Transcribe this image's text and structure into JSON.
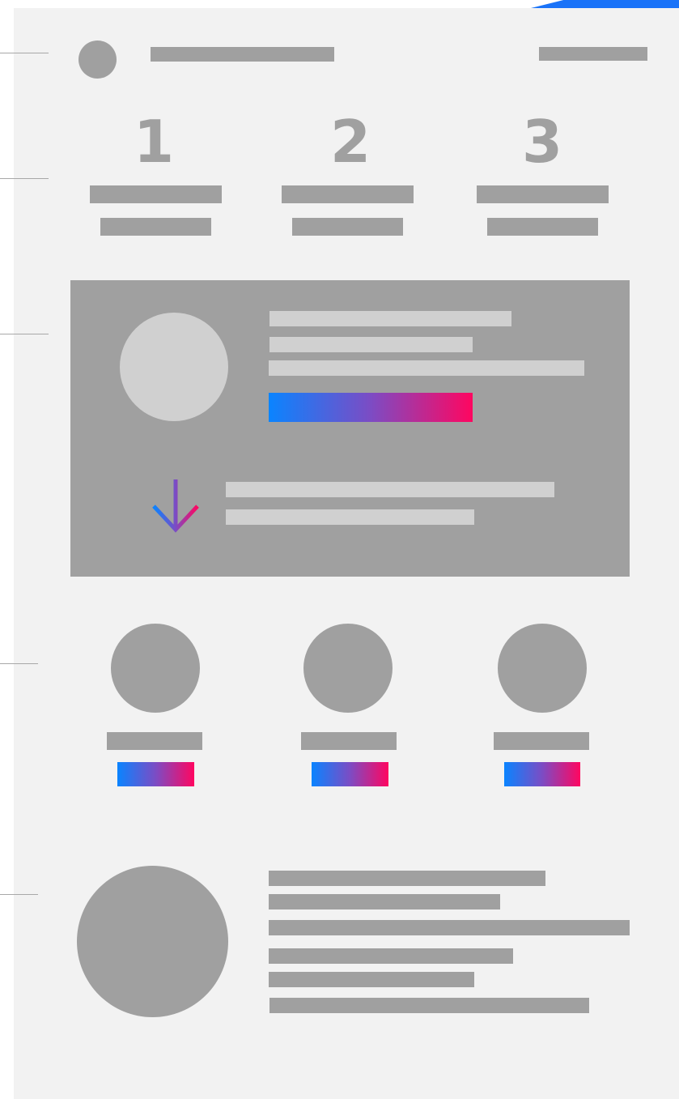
{
  "steps": {
    "items": [
      {
        "number": "1"
      },
      {
        "number": "2"
      },
      {
        "number": "3"
      }
    ]
  },
  "icons": {
    "logo": "circle-logo-icon",
    "arrow": "arrow-down-icon"
  },
  "colors": {
    "page_background": "#f2f2f2",
    "placeholder": "#a0a0a0",
    "placeholder_light": "#d0d0d0",
    "gradient_start": "#0a84ff",
    "gradient_mid": "#7c4cc4",
    "gradient_end": "#ff0660",
    "accent": "#1a73f8"
  }
}
